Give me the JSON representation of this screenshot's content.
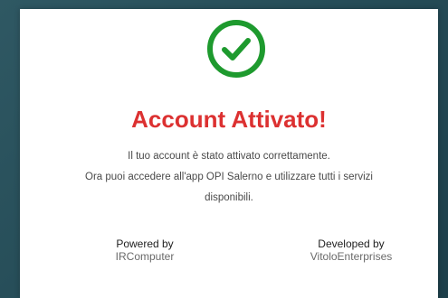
{
  "colors": {
    "success_icon": "#1e9a2e",
    "title": "#dc3131",
    "background": "#2a5460"
  },
  "icon": "check-circle-icon",
  "title": "Account Attivato!",
  "message": {
    "line1": "Il tuo account è stato attivato correttamente.",
    "line2": "Ora puoi accedere all'app OPI Salerno e utilizzare tutti i servizi",
    "line3": "disponibili."
  },
  "footer": {
    "powered_label": "Powered by",
    "powered_value": "IRComputer",
    "developed_label": "Developed by",
    "developed_value": "VitoloEnterprises"
  }
}
